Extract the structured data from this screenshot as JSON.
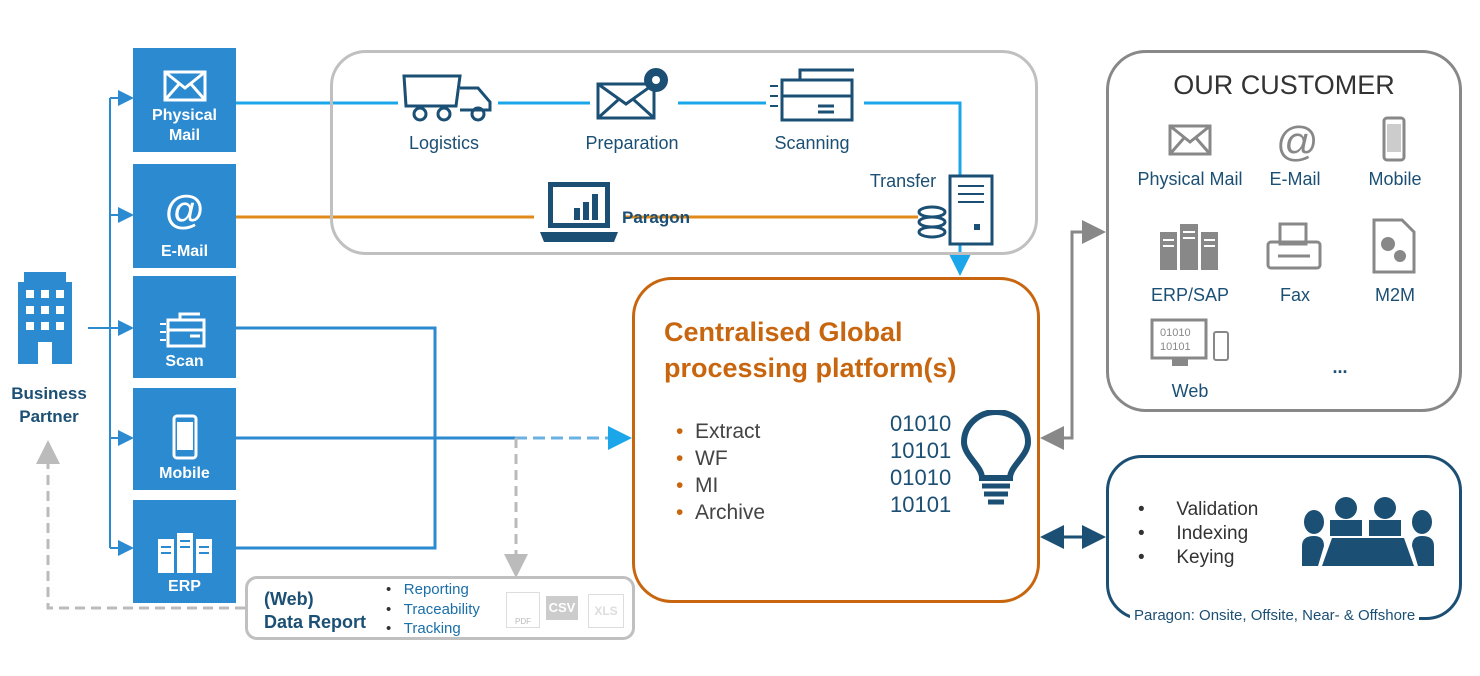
{
  "business_partner": "Business Partner",
  "channels": [
    {
      "label": "Physical Mail"
    },
    {
      "label": "E-Mail"
    },
    {
      "label": "Scan"
    },
    {
      "label": "Mobile"
    },
    {
      "label": "ERP"
    }
  ],
  "process": {
    "logistics": "Logistics",
    "preparation": "Preparation",
    "scanning": "Scanning",
    "transfer": "Transfer",
    "paragon": "Paragon"
  },
  "platform": {
    "title_line1": "Centralised Global",
    "title_line2": "processing platform(s)",
    "items": [
      "Extract",
      "WF",
      "MI",
      "Archive"
    ],
    "binary": [
      "01010",
      "10101",
      "01010",
      "10101"
    ]
  },
  "customer": {
    "title": "OUR CUSTOMER",
    "items": [
      "Physical Mail",
      "E-Mail",
      "Mobile",
      "ERP/SAP",
      "Fax",
      "M2M",
      "Web",
      "..."
    ]
  },
  "services": {
    "items": [
      "Validation",
      "Indexing",
      "Keying"
    ],
    "caption": "Paragon: Onsite, Offsite, Near- & Offshore"
  },
  "report": {
    "title_line1": "(Web)",
    "title_line2": "Data Report",
    "items": [
      "Reporting",
      "Traceability",
      "Tracking"
    ],
    "formats": [
      "PDF",
      "CSV",
      "XLS"
    ]
  },
  "colors": {
    "tile": "#2b8ad0",
    "navy": "#1b4f74",
    "orange": "#c8660f",
    "light_blue": "#1aa6e8",
    "orange_line": "#e08a1a",
    "gray": "#888888"
  }
}
